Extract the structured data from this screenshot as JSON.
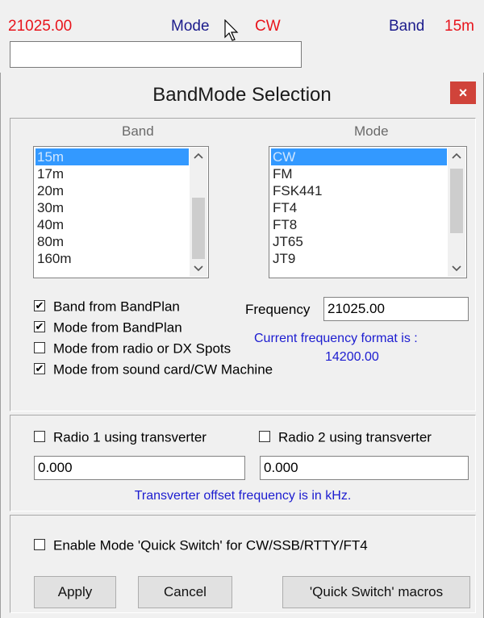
{
  "status": {
    "frequency": "21025.00",
    "mode_label": "Mode",
    "mode_value": "CW",
    "band_label": "Band",
    "band_value": "15m"
  },
  "dialog": {
    "title": "BandMode Selection",
    "close_glyph": "×"
  },
  "band_list": {
    "header": "Band",
    "items": [
      "15m",
      "17m",
      "20m",
      "30m",
      "40m",
      "80m",
      "160m"
    ],
    "selected": "15m"
  },
  "mode_list": {
    "header": "Mode",
    "items": [
      "CW",
      "FM",
      "FSK441",
      "FT4",
      "FT8",
      "JT65",
      "JT9"
    ],
    "selected": "CW"
  },
  "options": {
    "band_from_bandplan": {
      "label": "Band from BandPlan",
      "checked": true
    },
    "mode_from_bandplan": {
      "label": "Mode from BandPlan",
      "checked": true
    },
    "mode_from_radio": {
      "label": "Mode from radio or DX Spots",
      "checked": false
    },
    "mode_from_soundcard": {
      "label": "Mode from sound card/CW Machine",
      "checked": true
    }
  },
  "frequency": {
    "label": "Frequency",
    "value": "21025.00",
    "format_note": "Current frequency format is :",
    "format_example": "14200.00"
  },
  "transverter": {
    "radio1_label": "Radio 1 using transverter",
    "radio1_checked": false,
    "radio2_label": "Radio 2 using transverter",
    "radio2_checked": false,
    "radio1_offset": "0.000",
    "radio2_offset": "0.000",
    "note": "Transverter offset frequency is in kHz."
  },
  "quick_switch": {
    "label": "Enable Mode 'Quick Switch' for CW/SSB/RTTY/FT4",
    "checked": false
  },
  "buttons": {
    "apply": "Apply",
    "cancel": "Cancel",
    "macros": "'Quick Switch' macros"
  },
  "icons": {
    "check": "✔",
    "scroll_up": "^",
    "scroll_down": "v"
  },
  "colors": {
    "value_red": "#e8141c",
    "label_blue": "#1c1c8c",
    "note_blue": "#1c1cd0",
    "selection": "#3399ff",
    "close_red": "#d0433a"
  }
}
